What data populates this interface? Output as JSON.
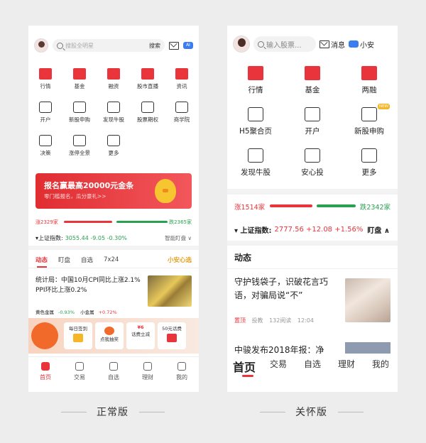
{
  "normal": {
    "search_placeholder": "搜股全明星",
    "search_button": "搜索",
    "ai_badge": "AI",
    "grid": [
      {
        "label": "行情",
        "icon": "market-icon",
        "style": "red"
      },
      {
        "label": "基金",
        "icon": "fund-icon",
        "style": "red"
      },
      {
        "label": "融资",
        "icon": "finance-icon",
        "style": "red"
      },
      {
        "label": "股市直播",
        "icon": "live-icon",
        "style": "red"
      },
      {
        "label": "资讯",
        "icon": "news-icon",
        "style": "red"
      },
      {
        "label": "开户",
        "icon": "open-account-icon",
        "style": "line"
      },
      {
        "label": "新股申购",
        "icon": "ipo-icon",
        "style": "line"
      },
      {
        "label": "发现牛股",
        "icon": "discover-icon",
        "style": "line"
      },
      {
        "label": "股票期权",
        "icon": "options-icon",
        "style": "line"
      },
      {
        "label": "商学院",
        "icon": "academy-icon",
        "style": "line"
      },
      {
        "label": "决策",
        "icon": "decision-icon",
        "style": "line"
      },
      {
        "label": "涨停全景",
        "icon": "limit-up-icon",
        "style": "line"
      },
      {
        "label": "更多",
        "icon": "more-icon",
        "style": "line"
      }
    ],
    "banner": {
      "title": "报名赢最高20000元金条",
      "subtitle": "零门槛报名，瓜分豪礼>>"
    },
    "breadth": {
      "up": "涨2329家",
      "down": "跌2365家"
    },
    "index": {
      "label": "▾上证指数:",
      "value": "3055.44 -9.05 -0.30%",
      "mode": "智能盯盘 ∨"
    },
    "tabs": [
      "动态",
      "盯盘",
      "自选",
      "7x24",
      "小安心选"
    ],
    "news": {
      "title": "统计局：中国10月CPI同比上涨2.1% PPI环比上涨0.2%",
      "tags": [
        {
          "name": "黄色金属",
          "change": "-0.93%"
        },
        {
          "name": "小金属",
          "change": "+0.72%"
        }
      ]
    },
    "promo_cards": [
      "每日签到",
      "点我抽奖",
      "话费立减",
      "50元话费"
    ],
    "promo_extra": "¥6",
    "tabbar": [
      "首页",
      "交易",
      "自选",
      "理财",
      "我的"
    ]
  },
  "care": {
    "search_placeholder": "输入股票...",
    "messages": "消息",
    "assistant": "小安",
    "grid": [
      {
        "label": "行情",
        "icon": "market-icon",
        "style": "red"
      },
      {
        "label": "基金",
        "icon": "fund-icon",
        "style": "red"
      },
      {
        "label": "两融",
        "icon": "margin-trading-icon",
        "style": "red"
      },
      {
        "label": "H5聚合页",
        "icon": "h5-icon",
        "style": "line"
      },
      {
        "label": "开户",
        "icon": "open-account-icon",
        "style": "line"
      },
      {
        "label": "新股申购",
        "icon": "ipo-icon",
        "style": "line"
      },
      {
        "label": "发现牛股",
        "icon": "discover-icon",
        "style": "line"
      },
      {
        "label": "安心投",
        "icon": "safe-invest-icon",
        "style": "line"
      },
      {
        "label": "更多",
        "icon": "more-icon",
        "style": "line"
      }
    ],
    "new_badge": "NEW",
    "breadth": {
      "up": "涨1514家",
      "down": "跌2342家"
    },
    "index": {
      "label": "▾ 上证指数:",
      "value": "2777.56 +12.08 +1.56%",
      "mode": "盯盘 ∧"
    },
    "section_title": "动态",
    "news": {
      "title": "守护钱袋子，识破花言巧语，对骗局说“不”"
    },
    "meta": {
      "tag": "置顶",
      "source": "投教",
      "reads": "132阅读",
      "time": "12:04"
    },
    "news2": "中骏发布2018年报：净",
    "tabbar": [
      "首页",
      "交易",
      "自选",
      "理财",
      "我的"
    ]
  },
  "captions": {
    "normal": "正常版",
    "care": "关怀版"
  },
  "colors": {
    "brand_red": "#e8343a",
    "up_red": "#e8343a",
    "down_green": "#2aa150",
    "background": "#ededed"
  }
}
